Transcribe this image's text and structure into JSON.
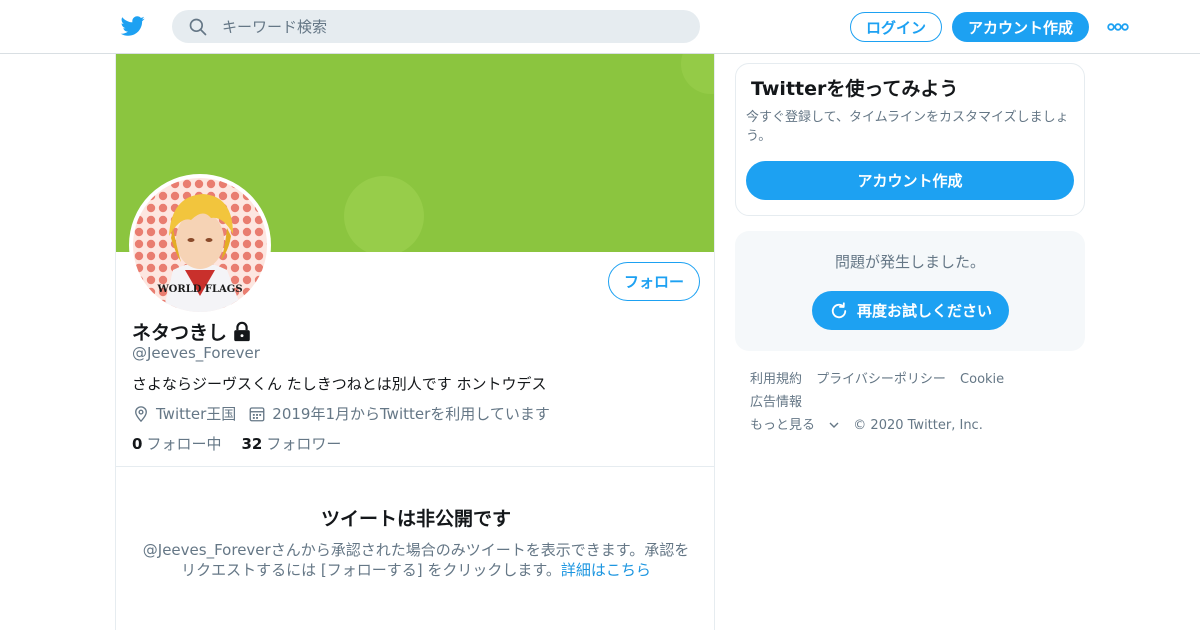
{
  "header": {
    "search_placeholder": "キーワード検索",
    "login_label": "ログイン",
    "signup_label": "アカウント作成"
  },
  "profile": {
    "name": "ネタつきし",
    "handle": "@Jeeves_Forever",
    "bio": "さよならジーヴスくん たしきつねとは別人です ホントウデス",
    "location": "Twitter王国",
    "joined": "2019年1月からTwitterを利用しています",
    "following_count": "0",
    "following_label": "フォロー中",
    "followers_count": "32",
    "followers_label": "フォロワー",
    "follow_button": "フォロー",
    "avatar_logo_text": "WORLD FLAGS"
  },
  "private_notice": {
    "title": "ツイートは非公開です",
    "text": "@Jeeves_Foreverさんから承認された場合のみツイートを表示できます。承認をリクエストするには [フォローする] をクリックします。",
    "link": "詳細はこちら"
  },
  "sidebar": {
    "signup_card": {
      "title": "Twitterを使ってみよう",
      "description": "今すぐ登録して、タイムラインをカスタマイズしましょう。",
      "button": "アカウント作成"
    },
    "error_card": {
      "message": "問題が発生しました。",
      "retry_button": "再度お試しください"
    },
    "footer": {
      "links": [
        "利用規約",
        "プライバシーポリシー",
        "Cookie",
        "広告情報",
        "もっと見る"
      ],
      "copyright": "© 2020 Twitter, Inc."
    }
  },
  "colors": {
    "brand": "#1da1f2",
    "banner": "#8bc53f",
    "muted_text": "#657786",
    "link": "#1b95e0"
  }
}
